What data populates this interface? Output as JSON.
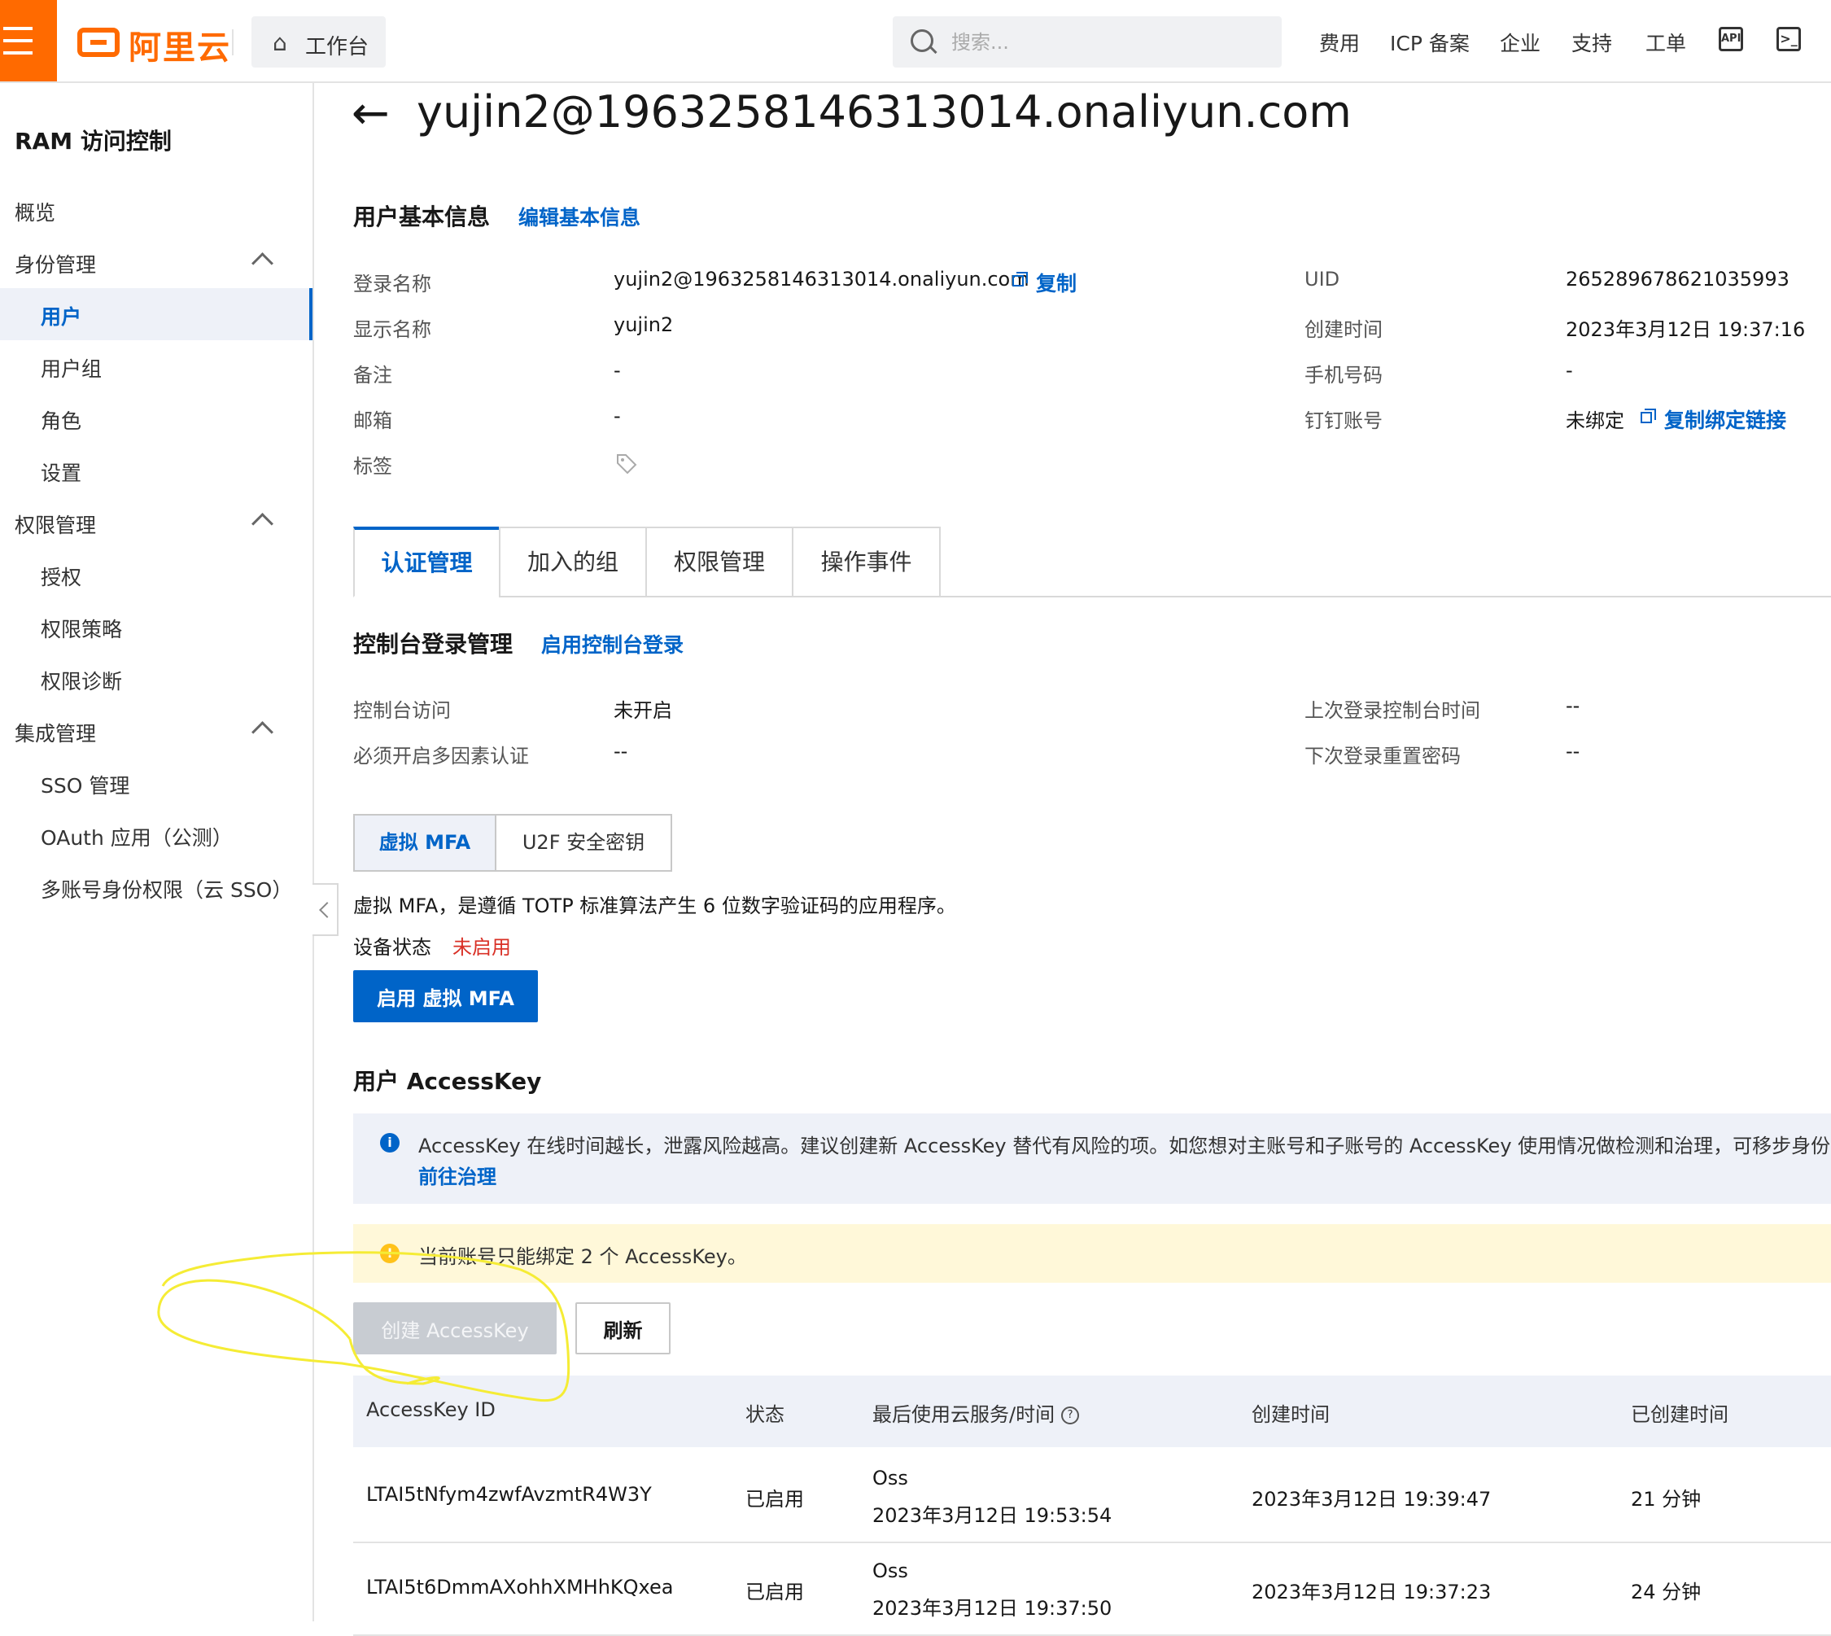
{
  "topbar": {
    "logo_text": "阿里云",
    "workbench": "工作台",
    "search_placeholder": "搜索...",
    "nav": [
      "费用",
      "ICP 备案",
      "企业",
      "支持",
      "工单"
    ],
    "api_icon_text": "API",
    "brand_color": "#ff6a00"
  },
  "sidebar": {
    "title": "RAM 访问控制",
    "items": [
      {
        "label": "概览"
      },
      {
        "label": "身份管理"
      },
      {
        "label": "用户"
      },
      {
        "label": "用户组"
      },
      {
        "label": "角色"
      },
      {
        "label": "设置"
      },
      {
        "label": "权限管理"
      },
      {
        "label": "授权"
      },
      {
        "label": "权限策略"
      },
      {
        "label": "权限诊断"
      },
      {
        "label": "集成管理"
      },
      {
        "label": "SSO 管理"
      },
      {
        "label": "OAuth 应用（公测）"
      },
      {
        "label": "多账号身份权限（云 SSO）"
      }
    ]
  },
  "page": {
    "title": "yujin2@1963258146313014.onaliyun.com"
  },
  "basic_info": {
    "section_title": "用户基本信息",
    "edit_link": "编辑基本信息",
    "login_name_label": "登录名称",
    "login_name_value": "yujin2@1963258146313014.onaliyun.com",
    "copy_label": "复制",
    "display_name_label": "显示名称",
    "display_name_value": "yujin2",
    "remark_label": "备注",
    "remark_value": "-",
    "email_label": "邮箱",
    "email_value": "-",
    "tags_label": "标签",
    "uid_label": "UID",
    "uid_value": "265289678621035993",
    "created_label": "创建时间",
    "created_value": "2023年3月12日 19:37:16",
    "phone_label": "手机号码",
    "phone_value": "-",
    "dingtalk_label": "钉钉账号",
    "dingtalk_value": "未绑定",
    "copy_bind_link": "复制绑定链接"
  },
  "tabs": [
    "认证管理",
    "加入的组",
    "权限管理",
    "操作事件"
  ],
  "console_login": {
    "section_title": "控制台登录管理",
    "enable_link": "启用控制台登录",
    "access_label": "控制台访问",
    "access_value": "未开启",
    "mfa_required_label": "必须开启多因素认证",
    "mfa_required_value": "--",
    "last_login_label": "上次登录控制台时间",
    "last_login_value": "--",
    "reset_pwd_label": "下次登录重置密码",
    "reset_pwd_value": "--"
  },
  "mfa": {
    "subtabs": [
      "虚拟 MFA",
      "U2F 安全密钥"
    ],
    "description": "虚拟 MFA，是遵循 TOTP 标准算法产生 6 位数字验证码的应用程序。",
    "status_label": "设备状态",
    "status_value": "未启用",
    "enable_button": "启用 虚拟 MFA"
  },
  "accesskey": {
    "section_title": "用户 AccessKey",
    "info_text": "AccessKey 在线时间越长，泄露风险越高。建议创建新 AccessKey 替代有风险的项。如您想对主账号和子账号的 AccessKey 使用情况做检测和治理，可移步身份",
    "info_link": "前往治理",
    "warn_text": "当前账号只能绑定 2 个 AccessKey。",
    "create_button": "创建 AccessKey",
    "refresh_button": "刷新",
    "columns": [
      "AccessKey ID",
      "状态",
      "最后使用云服务/时间",
      "创建时间",
      "已创建时间"
    ],
    "rows": [
      {
        "id": "LTAI5tNfym4zwfAvzmtR4W3Y",
        "status": "已启用",
        "service": "Oss",
        "last_used": "2023年3月12日 19:53:54",
        "created": "2023年3月12日 19:39:47",
        "age": "21 分钟"
      },
      {
        "id": "LTAI5t6DmmAXohhXMHhKQxea",
        "status": "已启用",
        "service": "Oss",
        "last_used": "2023年3月12日 19:37:50",
        "created": "2023年3月12日 19:37:23",
        "age": "24 分钟"
      }
    ]
  },
  "colors": {
    "accent": "#0064c8",
    "danger": "#d93026",
    "annotation": "#f5ec35"
  }
}
